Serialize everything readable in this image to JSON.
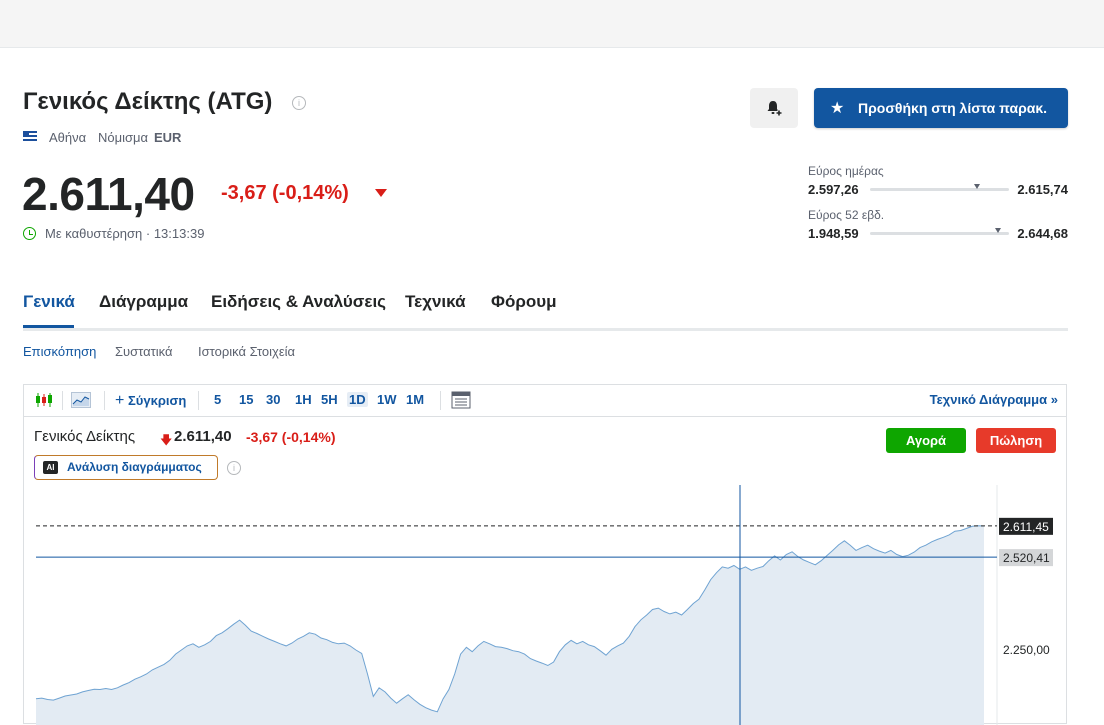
{
  "header": {
    "title": "Γενικός Δείκτης (ATG)",
    "exchange": "Αθήνα",
    "currency_label": "Νόμισμα",
    "currency_value": "EUR",
    "watchlist_label": "Προσθήκη στη λίστα παρακ."
  },
  "quote": {
    "price": "2.611,40",
    "change": "-3,67 (-0,14%)",
    "delay_text": "Με καθυστέρηση · 13:13:39"
  },
  "ranges": {
    "day": {
      "label": "Εύρος ημέρας",
      "low": "2.597,26",
      "high": "2.615,74",
      "position": 0.77
    },
    "week52": {
      "label": "Εύρος 52 εβδ.",
      "low": "1.948,59",
      "high": "2.644,68",
      "position": 0.92
    }
  },
  "tabs": [
    "Γενικά",
    "Διάγραμμα",
    "Ειδήσεις & Αναλύσεις",
    "Τεχνικά",
    "Φόρουμ"
  ],
  "subtabs": [
    "Επισκόπηση",
    "Συστατικά",
    "Ιστορικά Στοιχεία"
  ],
  "toolbar": {
    "compare_label": "Σύγκριση",
    "intervals": [
      "5",
      "15",
      "30",
      "1H",
      "5H",
      "1D",
      "1W",
      "1M"
    ],
    "active_interval": "1D",
    "technical_label": "Τεχνικό Διάγραμμα"
  },
  "chart_legend": {
    "name": "Γενικός Δείκτης",
    "price": "2.611,40",
    "change": "-3,67 (-0,14%)"
  },
  "buttons": {
    "buy": "Αγορά",
    "sell": "Πώληση",
    "ai": "Ανάλυση διαγράμματος",
    "ai_badge": "AI"
  },
  "colors": {
    "accent": "#1256a0",
    "negative": "#d91e18",
    "buy": "#0ea600",
    "sell": "#e73a2a"
  },
  "chart_data": {
    "type": "area",
    "y_ticks": [
      "2.250,00"
    ],
    "last_price_label": "2.611,45",
    "crosshair_label": "2.520,41",
    "ylim": [
      2070,
      2700
    ],
    "values": [
      2108,
      2110,
      2106,
      2104,
      2110,
      2116,
      2119,
      2122,
      2128,
      2132,
      2136,
      2135,
      2138,
      2135,
      2140,
      2148,
      2155,
      2165,
      2172,
      2180,
      2192,
      2200,
      2208,
      2220,
      2238,
      2250,
      2262,
      2268,
      2258,
      2265,
      2275,
      2292,
      2300,
      2312,
      2325,
      2337,
      2322,
      2305,
      2298,
      2290,
      2282,
      2275,
      2268,
      2262,
      2270,
      2282,
      2290,
      2300,
      2296,
      2285,
      2280,
      2272,
      2268,
      2270,
      2262,
      2250,
      2240,
      2180,
      2115,
      2140,
      2128,
      2110,
      2095,
      2108,
      2120,
      2105,
      2092,
      2082,
      2075,
      2070,
      2108,
      2135,
      2180,
      2238,
      2258,
      2245,
      2262,
      2275,
      2268,
      2260,
      2258,
      2254,
      2248,
      2245,
      2238,
      2225,
      2218,
      2212,
      2205,
      2215,
      2245,
      2265,
      2278,
      2268,
      2275,
      2265,
      2260,
      2248,
      2235,
      2252,
      2262,
      2270,
      2290,
      2318,
      2338,
      2352,
      2368,
      2372,
      2362,
      2355,
      2360,
      2352,
      2368,
      2385,
      2398,
      2425,
      2455,
      2475,
      2492,
      2488,
      2496,
      2485,
      2492,
      2482,
      2488,
      2493,
      2510,
      2524,
      2512,
      2528,
      2536,
      2522,
      2512,
      2505,
      2498,
      2510,
      2525,
      2540,
      2556,
      2568,
      2555,
      2540,
      2548,
      2555,
      2545,
      2538,
      2532,
      2540,
      2528,
      2522,
      2526,
      2535,
      2548,
      2555,
      2565,
      2572,
      2578,
      2585,
      2596,
      2598,
      2604,
      2610,
      2612,
      2611
    ]
  }
}
